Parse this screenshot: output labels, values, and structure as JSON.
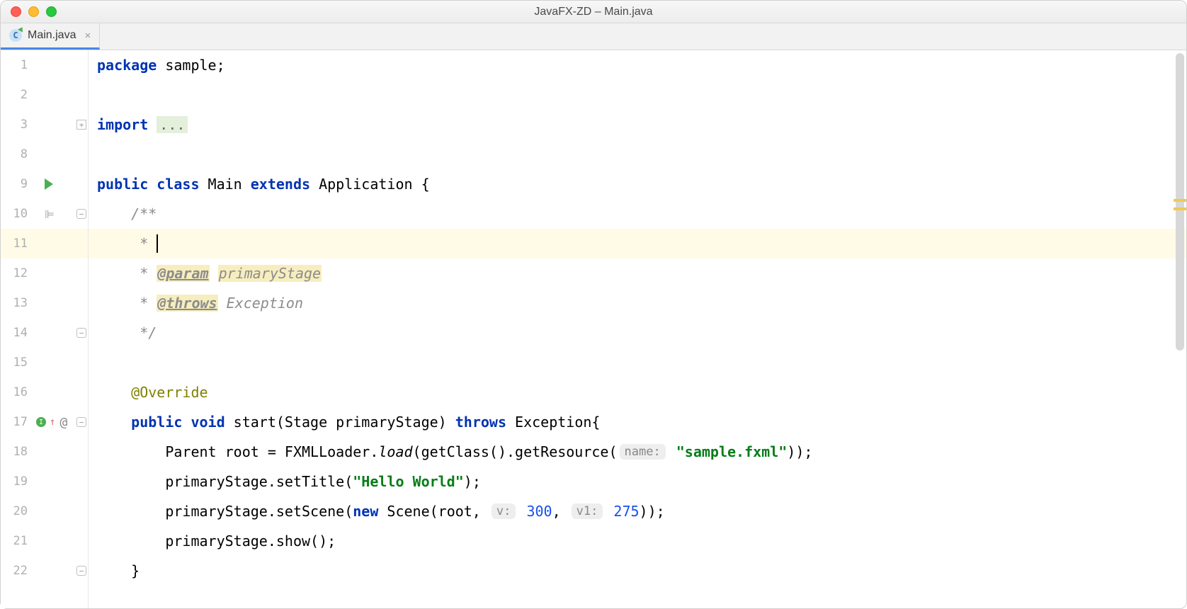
{
  "window": {
    "title": "JavaFX-ZD – Main.java"
  },
  "tab": {
    "label": "Main.java"
  },
  "gutter": {
    "lines": [
      "1",
      "2",
      "3",
      "8",
      "9",
      "10",
      "11",
      "12",
      "13",
      "14",
      "15",
      "16",
      "17",
      "18",
      "19",
      "20",
      "21",
      "22"
    ]
  },
  "code": {
    "l1_kw": "package",
    "l1_rest": " sample;",
    "l3_kw": "import",
    "l3_fold": "...",
    "l9_a": "public class",
    "l9_b": " Main ",
    "l9_c": "extends",
    "l9_d": " Application {",
    "l10": "    /**",
    "l11": "     * ",
    "l12_a": "     * ",
    "l12_tag": "@param",
    "l12_b": " ",
    "l12_c": "primaryStage",
    "l13_a": "     * ",
    "l13_tag": "@throws",
    "l13_b": " Exception",
    "l14": "     */",
    "l16": "    @Override",
    "l17_a": "public void",
    "l17_b": " start(Stage primaryStage) ",
    "l17_c": "throws",
    "l17_d": " Exception{",
    "l18_a": "        Parent root = FXMLLoader.",
    "l18_b": "load",
    "l18_c": "(getClass().getResource(",
    "l18_hint": "name:",
    "l18_d": " ",
    "l18_str": "\"sample.fxml\"",
    "l18_e": "));",
    "l19_a": "        primaryStage.setTitle(",
    "l19_str": "\"Hello World\"",
    "l19_b": ");",
    "l20_a": "        primaryStage.setScene(",
    "l20_kw": "new",
    "l20_b": " Scene(root, ",
    "l20_h1": "v:",
    "l20_n1": "300",
    "l20_c": ", ",
    "l20_h2": "v1:",
    "l20_n2": "275",
    "l20_d": "));",
    "l21": "        primaryStage.show();",
    "l22": "    }"
  }
}
